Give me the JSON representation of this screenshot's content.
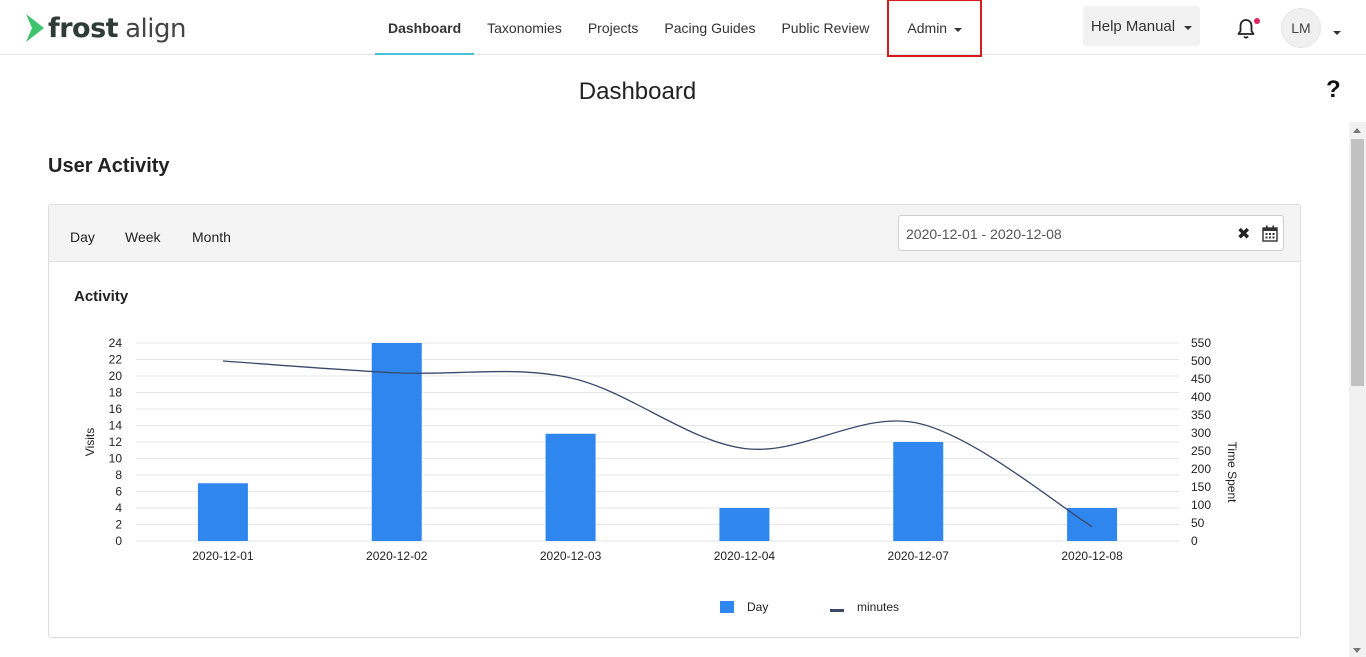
{
  "brand": {
    "logo_bold": "frost",
    "logo_light": "align",
    "accent": "#3cc36b"
  },
  "nav": {
    "items": [
      {
        "label": "Dashboard",
        "active": true
      },
      {
        "label": "Taxonomies",
        "active": false
      },
      {
        "label": "Projects",
        "active": false
      },
      {
        "label": "Pacing Guides",
        "active": false
      },
      {
        "label": "Public Review",
        "active": false
      }
    ],
    "admin_label": "Admin",
    "help_label": "Help Manual",
    "avatar_initials": "LM"
  },
  "page": {
    "title": "Dashboard",
    "help_icon": "?"
  },
  "section": {
    "title": "User Activity"
  },
  "filters": {
    "tabs": [
      "Day",
      "Week",
      "Month"
    ],
    "date_range": "2020-12-01 - 2020-12-08"
  },
  "chart_title": "Activity",
  "chart_data": {
    "type": "bar",
    "categories": [
      "2020-12-01",
      "2020-12-02",
      "2020-12-03",
      "2020-12-04",
      "2020-12-07",
      "2020-12-08"
    ],
    "series": [
      {
        "name": "Day",
        "type": "bar",
        "axis": "left",
        "values": [
          7,
          24,
          13,
          4,
          12,
          4
        ],
        "color": "#2f86ef"
      },
      {
        "name": "minutes",
        "type": "line",
        "axis": "right",
        "values": [
          500,
          467,
          453,
          257,
          327,
          40
        ],
        "color": "#3b4a6b"
      }
    ],
    "ylabel": "Visits",
    "ylabel_right": "Time Spent",
    "ylim": [
      0,
      24
    ],
    "ylim_right": [
      0,
      550
    ],
    "yticks": [
      0,
      2,
      4,
      6,
      8,
      10,
      12,
      14,
      16,
      18,
      20,
      22,
      24
    ],
    "yticks_right": [
      0,
      50,
      100,
      150,
      200,
      250,
      300,
      350,
      400,
      450,
      500,
      550
    ],
    "grid": true,
    "legend": "bottom"
  }
}
